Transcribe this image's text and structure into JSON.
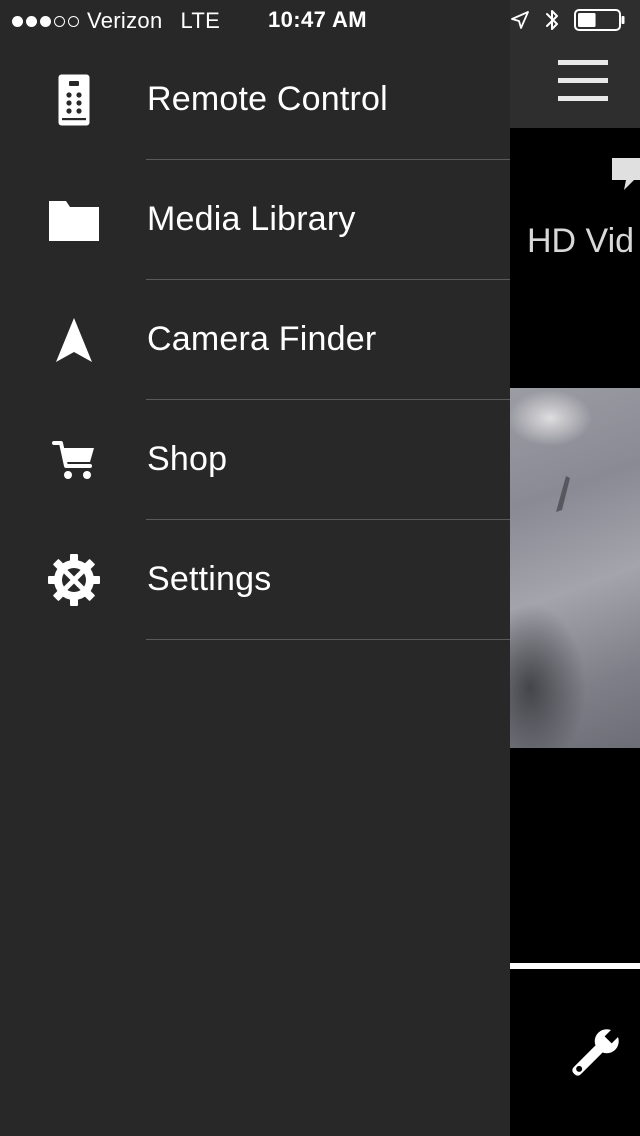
{
  "status_bar": {
    "signal_bars_filled": 3,
    "signal_bars_total": 5,
    "carrier": "Verizon",
    "network": "LTE",
    "time": "10:47 AM",
    "battery_level": 0.45,
    "icons": [
      "location-arrow-icon",
      "bluetooth-icon",
      "battery-icon"
    ]
  },
  "menu": {
    "items": [
      {
        "label": "Remote Control",
        "icon": "remote-control-icon"
      },
      {
        "label": "Media Library",
        "icon": "folder-icon"
      },
      {
        "label": "Camera Finder",
        "icon": "navigation-arrow-icon"
      },
      {
        "label": "Shop",
        "icon": "shopping-cart-icon"
      },
      {
        "label": "Settings",
        "icon": "gear-icon"
      }
    ]
  },
  "main_screen": {
    "mode_label": "HD Vid",
    "icons": [
      "hamburger-menu-icon",
      "video-mode-icon",
      "wrench-icon"
    ]
  },
  "colors": {
    "drawer_background": "#282828",
    "divider": "#5a5a5a",
    "main_background": "#000000",
    "header_background": "#2e2e2e",
    "text": "#ffffff"
  }
}
